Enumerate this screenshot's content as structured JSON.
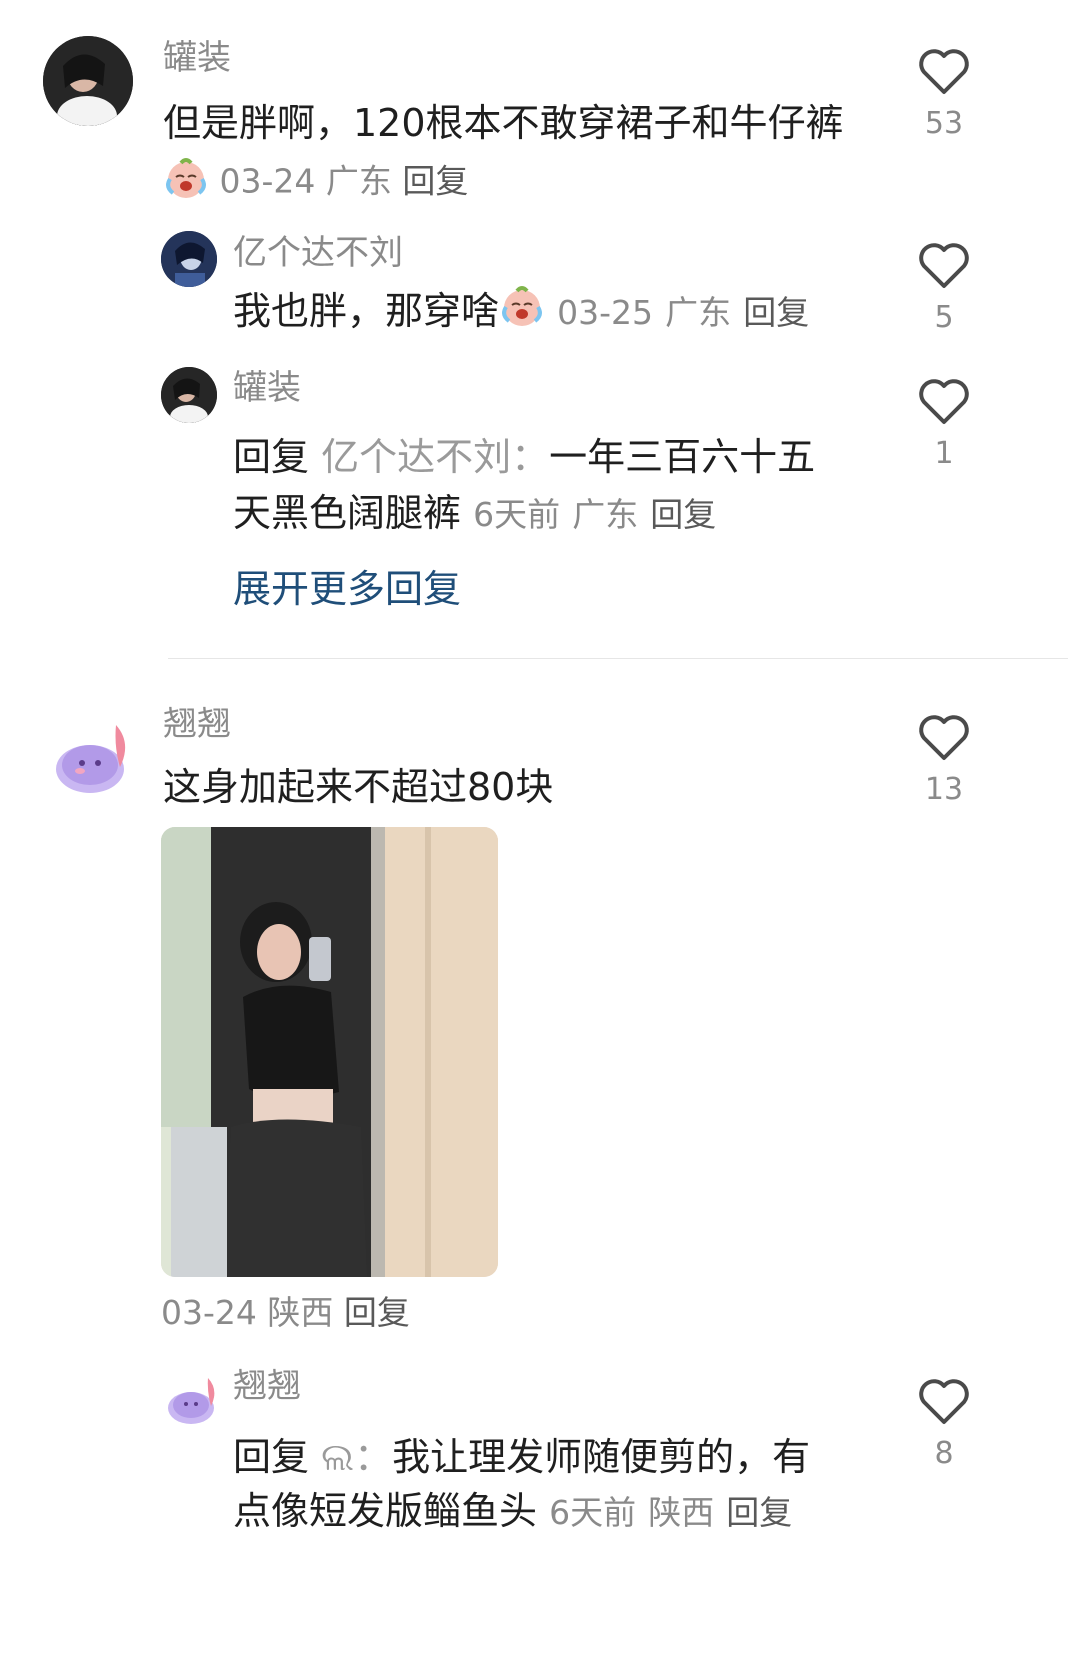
{
  "comments": [
    {
      "user": "罐装",
      "text": "但是胖啊，120根本不敢穿裙子和牛仔裤",
      "emoji": "crying-face-emoji",
      "date": "03-24",
      "location": "广东",
      "reply_label": "回复",
      "likes": "53",
      "replies": [
        {
          "user": "亿个达不刘",
          "text": "我也胖，那穿啥",
          "emoji": "crying-face-emoji",
          "date": "03-25",
          "location": "广东",
          "reply_label": "回复",
          "likes": "5"
        },
        {
          "user": "罐装",
          "prefix": "回复",
          "target": "亿个达不刘：",
          "text_line1": "一年三百六十五",
          "text_line2": "天黑色阔腿裤",
          "date": "6天前",
          "location": "广东",
          "reply_label": "回复",
          "likes": "1"
        }
      ],
      "expand_more": "展开更多回复"
    },
    {
      "user": "翘翘",
      "text": "这身加起来不超过80块",
      "date": "03-24",
      "location": "陕西",
      "reply_label": "回复",
      "likes": "13",
      "replies": [
        {
          "user": "翘翘",
          "prefix": "回复",
          "target": "ଲ：",
          "text_line1": "我让理发师随便剪的，有",
          "text_line2": "点像短发版鲻鱼头",
          "date": "6天前",
          "location": "陕西",
          "reply_label": "回复",
          "likes": "8"
        }
      ]
    }
  ],
  "colors": {
    "text": "#1f1f1f",
    "meta": "#8a8a8a",
    "link": "#1f4e79",
    "divider": "#e6e6e6"
  }
}
